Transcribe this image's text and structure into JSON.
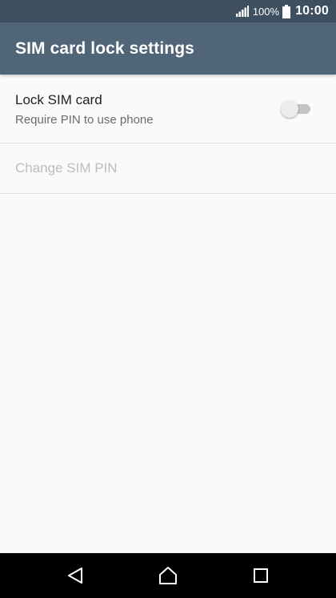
{
  "status_bar": {
    "battery_percent": "100%",
    "time": "10:00",
    "icons": [
      "signal-icon",
      "battery-icon"
    ]
  },
  "app_bar": {
    "title": "SIM card lock settings"
  },
  "preferences": {
    "lock_sim": {
      "title": "Lock SIM card",
      "summary": "Require PIN to use phone",
      "toggle_state": "off"
    },
    "change_pin": {
      "title": "Change SIM PIN",
      "enabled": false
    }
  },
  "nav_bar": {
    "buttons": [
      "back-icon",
      "home-icon",
      "recent-apps-icon"
    ]
  },
  "colors": {
    "status_bar": "#3e4f60",
    "app_bar": "#506577",
    "background": "#fafafa",
    "disabled_text": "#bdbdbd"
  }
}
